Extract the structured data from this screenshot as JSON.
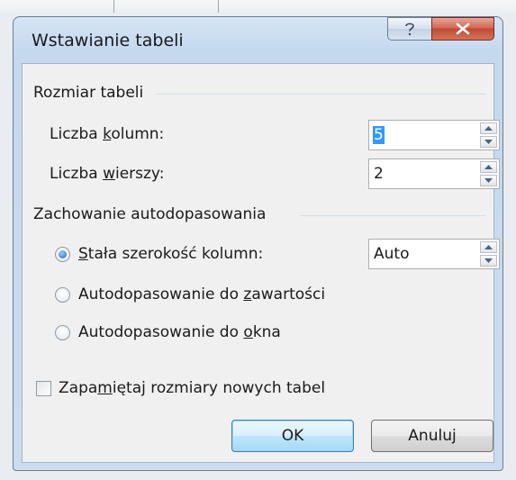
{
  "dialog": {
    "title": "Wstawianie tabeli"
  },
  "table_size": {
    "group_label": "Rozmiar tabeli",
    "columns_label_pre": "Liczba ",
    "columns_label_key": "k",
    "columns_label_post": "olumn:",
    "columns_value": "5",
    "rows_label_pre": "Liczba ",
    "rows_label_key": "w",
    "rows_label_post": "ierszy:",
    "rows_value": "2"
  },
  "autofit": {
    "group_label": "Zachowanie autodopasowania",
    "fixed_key": "S",
    "fixed_post": "tała szerokość kolumn:",
    "fixed_value": "Auto",
    "fixed_selected": true,
    "contents_pre": "Autodopasowanie do ",
    "contents_key": "z",
    "contents_post": "awartości",
    "window_pre": "Autodopasowanie do ",
    "window_key": "o",
    "window_post": "kna"
  },
  "remember": {
    "pre": "Zapa",
    "key": "m",
    "post": "iętaj rozmiary nowych tabel",
    "checked": false
  },
  "buttons": {
    "ok": "OK",
    "cancel": "Anuluj"
  },
  "icons": {
    "help": "question-mark-icon",
    "close": "close-x-icon",
    "spin_up": "triangle-up-icon",
    "spin_down": "triangle-down-icon"
  },
  "colors": {
    "selection": "#3399ff",
    "close_button": "#c14a34",
    "default_button_border": "#3c7fb1",
    "radio_dot": "#1766c2"
  }
}
